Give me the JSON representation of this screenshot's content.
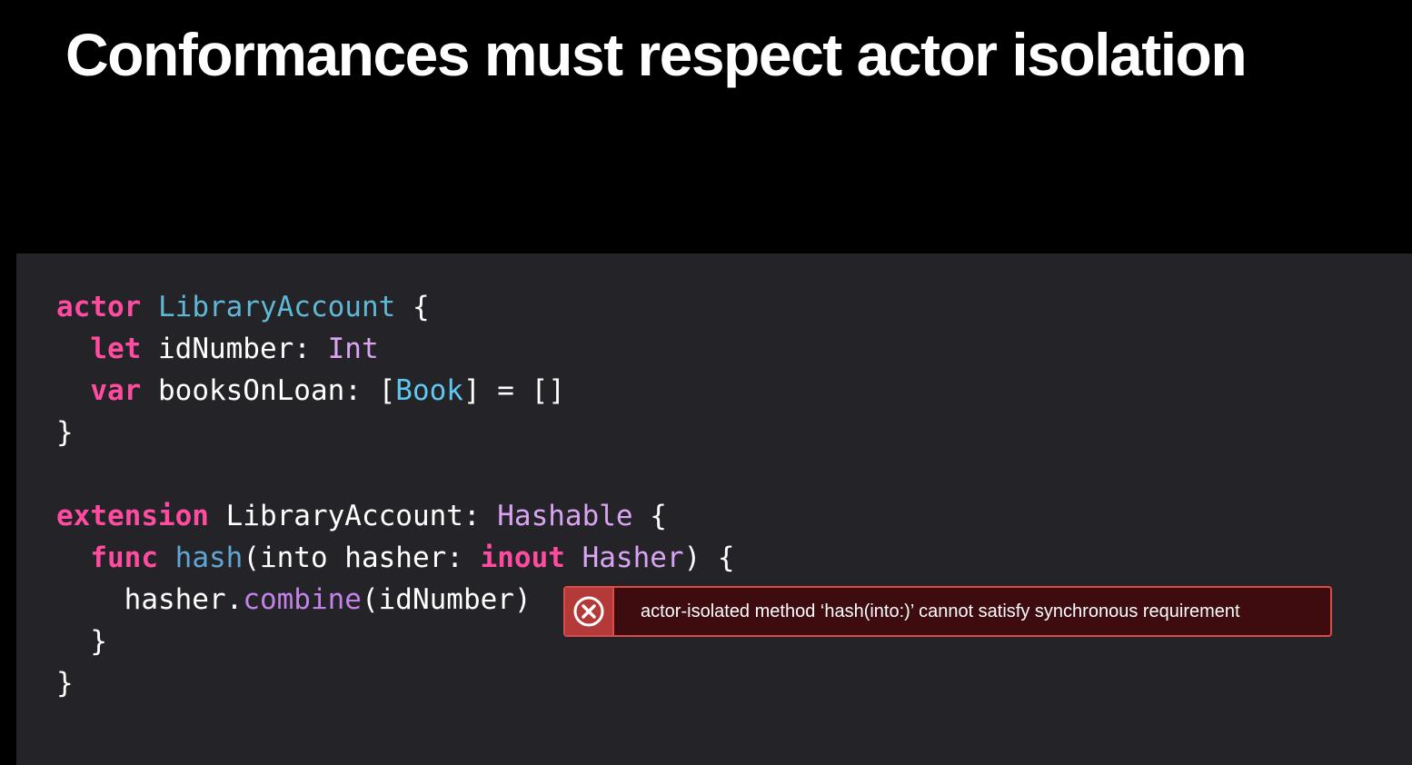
{
  "slide": {
    "title": "Conformances must respect actor isolation"
  },
  "code": {
    "lines": [
      [
        {
          "t": "actor",
          "c": "kw"
        },
        {
          "t": " ",
          "c": "plain"
        },
        {
          "t": "LibraryAccount",
          "c": "tydecl"
        },
        {
          "t": " {",
          "c": "plain"
        }
      ],
      [
        {
          "t": "  ",
          "c": "plain"
        },
        {
          "t": "let",
          "c": "kw"
        },
        {
          "t": " idNumber: ",
          "c": "plain"
        },
        {
          "t": "Int",
          "c": "ty"
        }
      ],
      [
        {
          "t": "  ",
          "c": "plain"
        },
        {
          "t": "var",
          "c": "kw"
        },
        {
          "t": " booksOnLoan: [",
          "c": "plain"
        },
        {
          "t": "Book",
          "c": "tyref"
        },
        {
          "t": "] = []",
          "c": "plain"
        }
      ],
      [
        {
          "t": "}",
          "c": "plain"
        }
      ],
      [],
      [
        {
          "t": "extension",
          "c": "kw"
        },
        {
          "t": " LibraryAccount: ",
          "c": "plain"
        },
        {
          "t": "Hashable",
          "c": "ty"
        },
        {
          "t": " {",
          "c": "plain"
        }
      ],
      [
        {
          "t": "  ",
          "c": "plain"
        },
        {
          "t": "func",
          "c": "kw"
        },
        {
          "t": " ",
          "c": "plain"
        },
        {
          "t": "hash",
          "c": "fndecl"
        },
        {
          "t": "(into hasher: ",
          "c": "plain"
        },
        {
          "t": "inout",
          "c": "kw"
        },
        {
          "t": " ",
          "c": "plain"
        },
        {
          "t": "Hasher",
          "c": "ty"
        },
        {
          "t": ") {",
          "c": "plain"
        }
      ],
      [
        {
          "t": "    hasher.",
          "c": "plain"
        },
        {
          "t": "combine",
          "c": "fn"
        },
        {
          "t": "(idNumber)",
          "c": "plain"
        }
      ],
      [
        {
          "t": "  }",
          "c": "plain"
        }
      ],
      [
        {
          "t": "}",
          "c": "plain"
        }
      ]
    ]
  },
  "error": {
    "icon": "error-x-icon",
    "message": "actor-isolated method ‘hash(into:)’ cannot satisfy synchronous requirement"
  },
  "colors": {
    "background": "#000000",
    "code_panel": "#242428",
    "keyword": "#ff4ba0",
    "type": "#d9a4f2",
    "error_fill": "#3e0b0e",
    "error_border": "#d94c4a"
  }
}
